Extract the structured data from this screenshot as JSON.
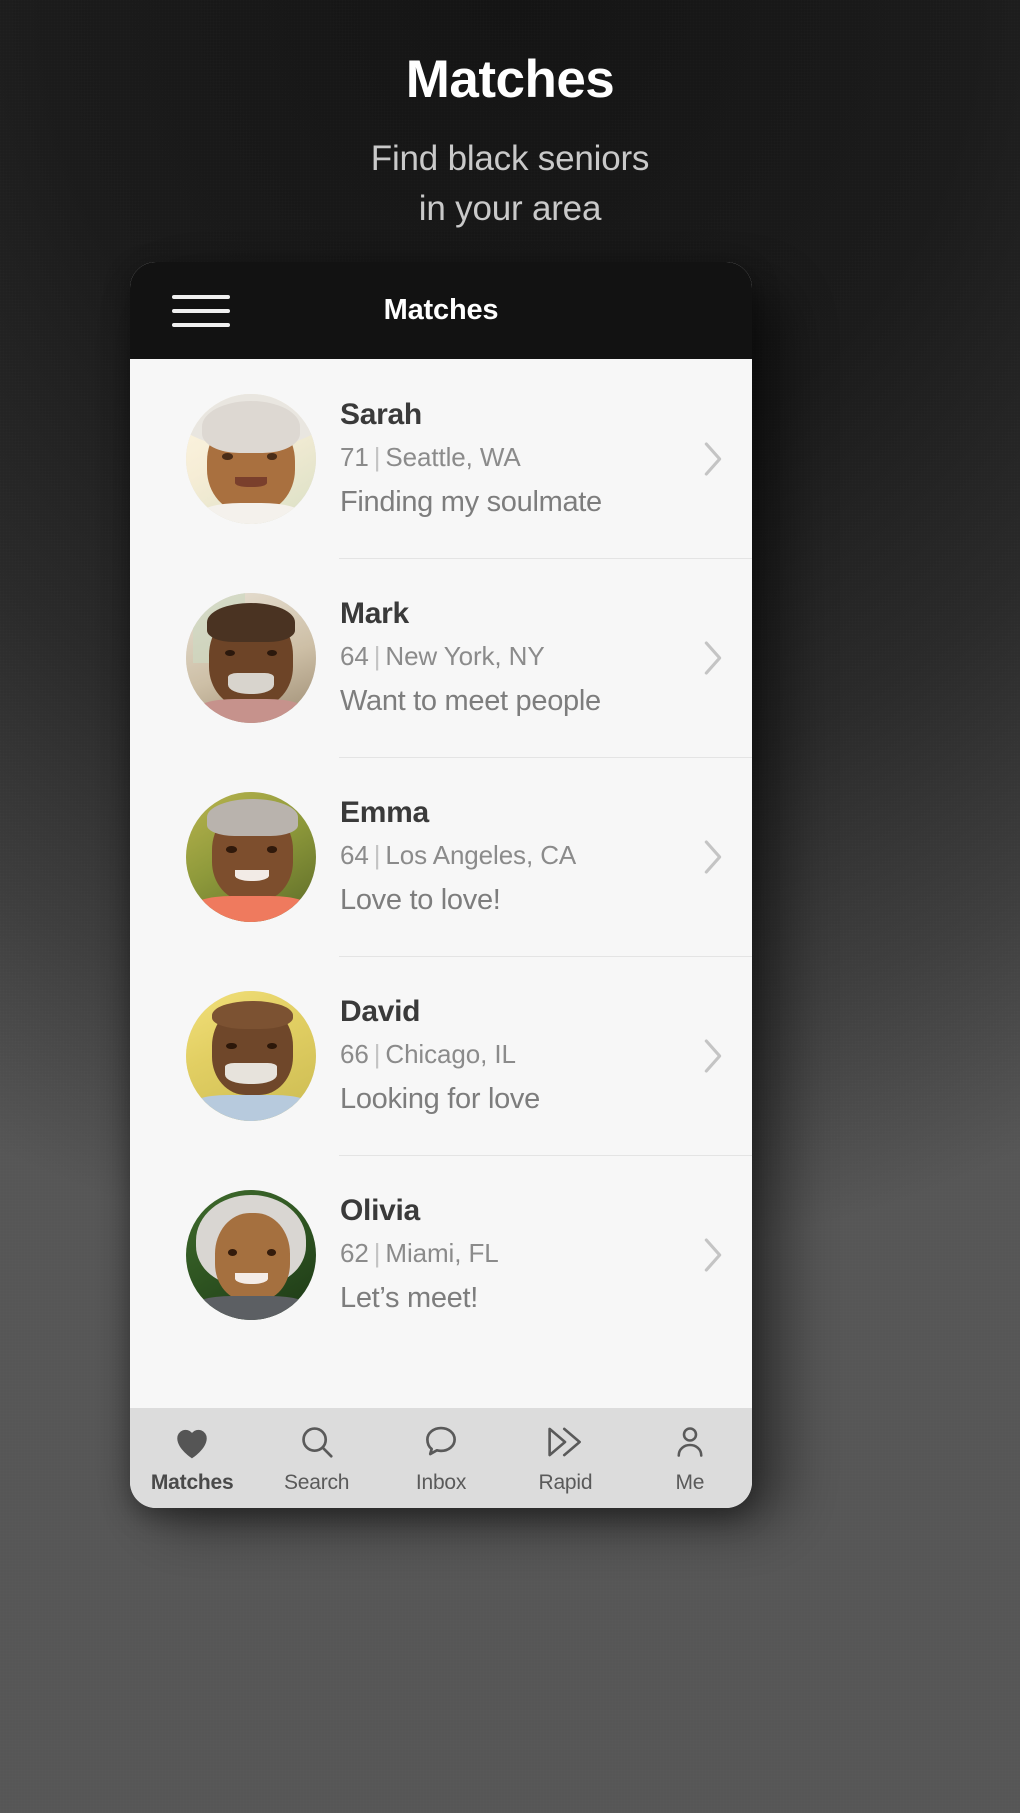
{
  "hero": {
    "title": "Matches",
    "subtitle_line1": "Find black seniors",
    "subtitle_line2": "in your area"
  },
  "app": {
    "menu_icon": "hamburger-menu-icon",
    "appbar_title": "Matches"
  },
  "matches": [
    {
      "name": "Sarah",
      "age": "71",
      "separator": "|",
      "location": "Seattle, WA",
      "tagline": "Finding my soulmate",
      "chevron": "chevron-right-icon",
      "avatar": "photo-sarah"
    },
    {
      "name": "Mark",
      "age": "64",
      "separator": "|",
      "location": "New York, NY",
      "tagline": "Want to meet people",
      "chevron": "chevron-right-icon",
      "avatar": "photo-mark"
    },
    {
      "name": "Emma",
      "age": "64",
      "separator": "|",
      "location": "Los Angeles, CA",
      "tagline": "Love to love!",
      "chevron": "chevron-right-icon",
      "avatar": "photo-emma"
    },
    {
      "name": "David",
      "age": "66",
      "separator": "|",
      "location": "Chicago, IL",
      "tagline": "Looking for love",
      "chevron": "chevron-right-icon",
      "avatar": "photo-david"
    },
    {
      "name": "Olivia",
      "age": "62",
      "separator": "|",
      "location": "Miami, FL",
      "tagline": "Let’s meet!",
      "chevron": "chevron-right-icon",
      "avatar": "photo-olivia"
    }
  ],
  "nav": [
    {
      "label": "Matches",
      "icon": "heart-filled-icon",
      "active": true
    },
    {
      "label": "Search",
      "icon": "magnifier-icon",
      "active": false
    },
    {
      "label": "Inbox",
      "icon": "speech-bubble-icon",
      "active": false
    },
    {
      "label": "Rapid",
      "icon": "double-chevron-icon",
      "active": false
    },
    {
      "label": "Me",
      "icon": "person-icon",
      "active": false
    }
  ],
  "colors": {
    "background_dark": "#1b1b1b",
    "appbar": "#121212",
    "list_bg": "#f7f7f7",
    "navbar_bg": "#dcdcdc",
    "name_text": "#3a3a3a",
    "meta_text": "#8b8b8b",
    "tagline_text": "#7d7d7d",
    "hero_title": "#ffffff",
    "hero_subtitle": "#c9c9c9"
  }
}
